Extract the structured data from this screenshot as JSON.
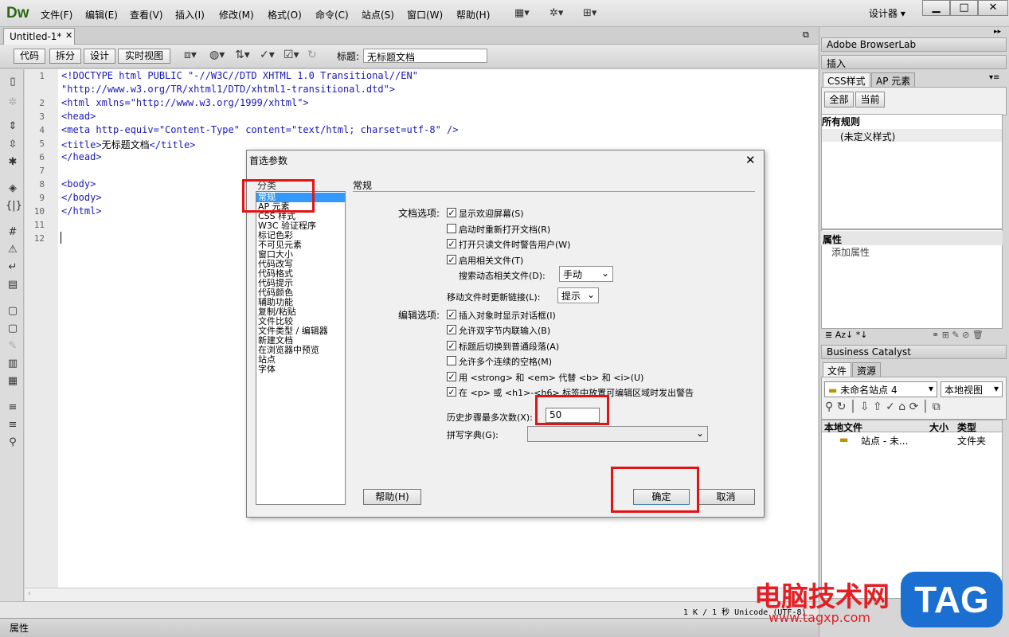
{
  "app": {
    "logo": "Dw",
    "menus": [
      "文件(F)",
      "编辑(E)",
      "查看(V)",
      "插入(I)",
      "修改(M)",
      "格式(O)",
      "命令(C)",
      "站点(S)",
      "窗口(W)",
      "帮助(H)"
    ],
    "toolbar_icons": [
      "layout-icon",
      "gear-icon",
      "site-icon"
    ],
    "workspace": "设计器",
    "window_buttons": [
      "minimize-icon",
      "maximize-icon",
      "close-icon"
    ]
  },
  "document": {
    "tab": "Untitled-1*",
    "view_buttons": [
      "代码",
      "拆分",
      "设计",
      "实时视图"
    ],
    "title_label": "标题:",
    "title_value": "无标题文档",
    "line_numbers": [
      "1",
      "",
      "2",
      "3",
      "4",
      "5",
      "6",
      "7",
      "8",
      "9",
      "10",
      "11",
      "12"
    ],
    "code_lines": [
      "<!DOCTYPE html PUBLIC \"-//W3C//DTD XHTML 1.0 Transitional//EN\"",
      "\"http://www.w3.org/TR/xhtml1/DTD/xhtml1-transitional.dtd\">",
      "<html xmlns=\"http://www.w3.org/1999/xhtml\">",
      "<head>",
      "<meta http-equiv=\"Content-Type\" content=\"text/html; charset=utf-8\" />",
      "<title>",
      "无标题文档",
      "</title>",
      "</head>",
      "",
      "<body>",
      "</body>",
      "</html>"
    ],
    "status": "1 K / 1 秒  Unicode (UTF-8)",
    "properties_label": "属性"
  },
  "panels": {
    "browserlab": "Adobe BrowserLab",
    "insert": "插入",
    "css_tabs": [
      "CSS样式",
      "AP 元素"
    ],
    "css_buttons": [
      "全部",
      "当前"
    ],
    "all_rules": "所有规则",
    "rule_item": "(未定义样式)",
    "properties": "属性",
    "add_property": "添加属性",
    "business_catalyst": "Business Catalyst",
    "files_tabs": [
      "文件",
      "资源"
    ],
    "site_select": "未命名站点 4",
    "view_select": "本地视图",
    "files_columns": [
      "本地文件",
      "大小",
      "类型"
    ],
    "file_row": {
      "name": "站点 - 未...",
      "type": "文件夹"
    }
  },
  "dialog": {
    "title": "首选参数",
    "category_label": "分类",
    "categories": [
      "常规",
      "AP 元素",
      "CSS 样式",
      "W3C 验证程序",
      "标记色彩",
      "不可见元素",
      "窗口大小",
      "代码改写",
      "代码格式",
      "代码提示",
      "代码颜色",
      "辅助功能",
      "复制/粘贴",
      "文件比较",
      "文件类型 / 编辑器",
      "新建文档",
      "在浏览器中预览",
      "站点",
      "字体"
    ],
    "section_title": "常规",
    "doc_options_label": "文档选项:",
    "doc_options": [
      {
        "label": "显示欢迎屏幕(S)",
        "checked": true
      },
      {
        "label": "启动时重新打开文档(R)",
        "checked": false
      },
      {
        "label": "打开只读文件时警告用户(W)",
        "checked": true
      },
      {
        "label": "启用相关文件(T)",
        "checked": true
      }
    ],
    "search_dynamic_label": "搜索动态相关文件(D):",
    "search_dynamic_value": "手动",
    "move_file_label": "移动文件时更新链接(L):",
    "move_file_value": "提示",
    "edit_options_label": "编辑选项:",
    "edit_options": [
      {
        "label": "插入对象时显示对话框(I)",
        "checked": true
      },
      {
        "label": "允许双字节内联输入(B)",
        "checked": true
      },
      {
        "label": "标题后切换到普通段落(A)",
        "checked": true
      },
      {
        "label": "允许多个连续的空格(M)",
        "checked": false
      },
      {
        "label": "用 <strong> 和 <em> 代替 <b> 和 <i>(U)",
        "checked": true
      },
      {
        "label": "在 <p> 或 <h1>-<h6> 标签中放置可编辑区域时发出警告",
        "checked": true
      }
    ],
    "history_label": "历史步骤最多次数(X):",
    "history_value": "50",
    "spell_label": "拼写字典(G):",
    "spell_value": "",
    "help_button": "帮助(H)",
    "ok_button": "确定",
    "cancel_button": "取消"
  },
  "watermark": {
    "site_name": "电脑技术网",
    "url": "www.tagxp.com",
    "tag": "TAG"
  },
  "colors": {
    "highlight": "#e31313",
    "selection": "#3399ff",
    "code_tag": "#1a1ab5"
  }
}
